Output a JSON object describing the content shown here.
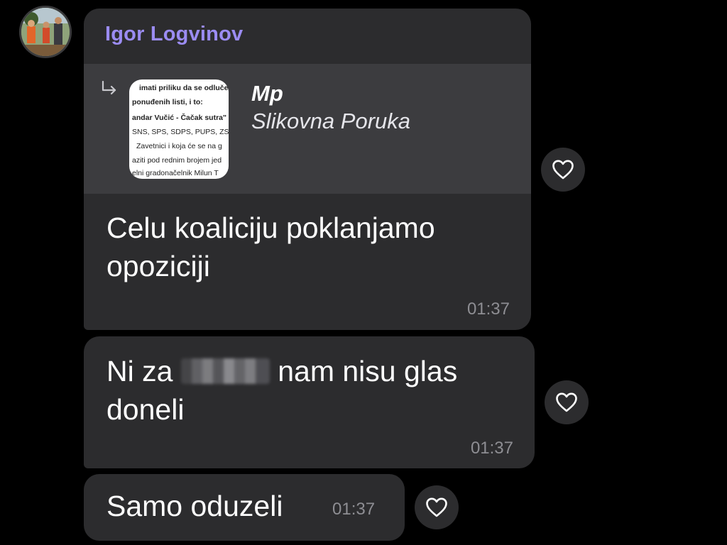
{
  "sender": {
    "name": "Igor Logvinov",
    "name_color": "#9b8cf2"
  },
  "messages": [
    {
      "quote": {
        "icon": "reply-arrow-icon",
        "title": "Mp",
        "subtitle": "Slikovna Poruka",
        "thumbnail_lines": [
          "imati priliku da se odluče",
          "ponuđenih listi, i to:",
          "andar Vučić - Čačak sutra\"",
          "SNS, SPS, SDPS, PUPS, ZS,",
          "Zavetnici i koja će se na g",
          "aziti pod rednim brojem jed",
          "elni gradonačelnik Milun T"
        ]
      },
      "text": "Celu koaliciju poklanjamo opoziciji",
      "time": "01:37"
    },
    {
      "text_before": "Ni za",
      "text_after": "nam nisu glas doneli",
      "time": "01:37"
    },
    {
      "text": "Samo oduzeli",
      "time": "01:37"
    }
  ],
  "colors": {
    "background": "#000000",
    "bubble": "#2c2c2e",
    "quote_background": "#3c3c3f",
    "timestamp": "#8e8e93"
  }
}
